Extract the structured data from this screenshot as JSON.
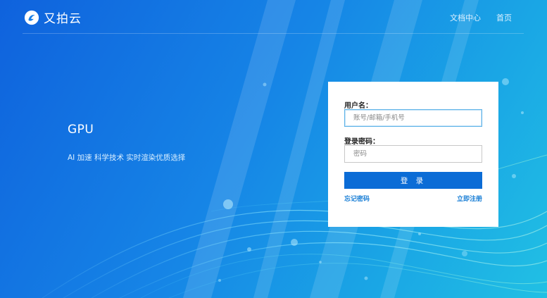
{
  "header": {
    "logo_text": "又拍云",
    "nav": [
      {
        "label": "文档中心"
      },
      {
        "label": "首页"
      }
    ]
  },
  "hero": {
    "title": "GPU",
    "subtitle": "AI 加速 科学技术 实时渲染优质选择"
  },
  "login": {
    "username_label": "用户名：",
    "username_placeholder": "账号/邮箱/手机号",
    "password_label": "登录密码：",
    "password_placeholder": "密码",
    "submit_label": "登 录",
    "forgot_label": "忘记密码",
    "register_label": "立即注册"
  },
  "colors": {
    "accent": "#0b6cd6",
    "link": "#1a7fd6",
    "focus_border": "#5fb3e8"
  }
}
